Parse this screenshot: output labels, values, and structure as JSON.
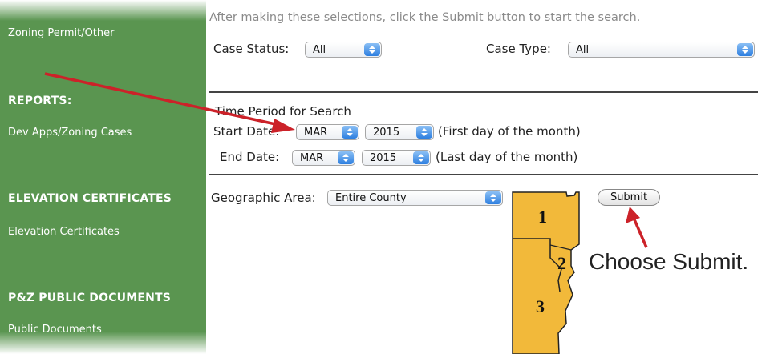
{
  "sidebar": {
    "top_link": "Zoning Permit/Other",
    "sections": [
      {
        "heading": "REPORTS:",
        "link": "Dev Apps/Zoning Cases"
      },
      {
        "heading": "ELEVATION CERTIFICATES",
        "link": "Elevation Certificates"
      },
      {
        "heading": "P&Z PUBLIC DOCUMENTS",
        "link": "Public Documents"
      }
    ]
  },
  "main": {
    "instructions": "After making these selections, click the Submit button to start the search.",
    "case_status": {
      "label": "Case Status:",
      "value": "All"
    },
    "case_type": {
      "label": "Case Type:",
      "value": "All"
    },
    "time_period": {
      "title": "Time Period for Search",
      "start_label": "Start Date:",
      "start_month": "MAR",
      "start_year": "2015",
      "start_note": "(First day of the month)",
      "end_label": "End Date:",
      "end_month": "MAR",
      "end_year": "2015",
      "end_note": "(Last day of the month)"
    },
    "geographic": {
      "label": "Geographic Area:",
      "value": "Entire County"
    },
    "map": {
      "regions": [
        "1",
        "2",
        "3"
      ],
      "fill_color": "#f2b93a"
    },
    "submit_label": "Submit"
  },
  "annotation": {
    "text": "Choose Submit.",
    "arrow_color": "#cc2229"
  }
}
